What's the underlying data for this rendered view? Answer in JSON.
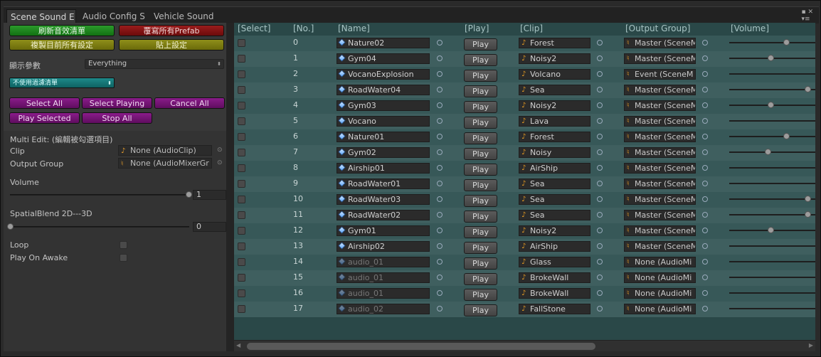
{
  "tabs": [
    "Scene Sound E",
    "Audio Config S",
    "Vehicle Sound"
  ],
  "window_controls": "▪ ✕\n▾≡",
  "left": {
    "buttons": {
      "refresh": "刷新音效清單",
      "override": "覆寫所有Prefab",
      "copy": "複製目前所有設定",
      "paste": "貼上設定"
    },
    "display_label": "顯示參數",
    "display_value": "Everything",
    "filter_value": "不使用過濾清單",
    "select_all": "Select All",
    "select_playing": "Select Playing",
    "cancel_all": "Cancel All",
    "play_selected": "Play Selected",
    "stop_all": "Stop All",
    "multi_edit": "Multi Edit: (編輯被勾選項目)",
    "clip_label": "Clip",
    "clip_value": "None (AudioClip)",
    "output_label": "Output Group",
    "output_value": "None (AudioMixerGr",
    "volume_label": "Volume",
    "volume_value": "1",
    "volume_level": 1,
    "spatial_label": "SpatialBlend 2D---3D",
    "spatial_value": "0",
    "spatial_level": 0,
    "loop_label": "Loop",
    "awake_label": "Play On Awake"
  },
  "headers": {
    "select": "[Select]",
    "no": "[No.]",
    "name": "[Name]",
    "play": "[Play]",
    "clip": "[Clip]",
    "output": "[Output Group]",
    "volume": "[Volume]"
  },
  "play_label": "Play",
  "rows": [
    {
      "no": "0",
      "name": "Nature02",
      "clip": "Forest",
      "output": "Master (SceneM",
      "volume": 0.55,
      "dim": false
    },
    {
      "no": "1",
      "name": "Gym04",
      "clip": "Noisy2",
      "output": "Master (SceneM",
      "volume": 0.4,
      "dim": false
    },
    {
      "no": "2",
      "name": "VocanoExplosion",
      "clip": "Volcano",
      "output": "Event (SceneM",
      "volume": 1.0,
      "dim": false
    },
    {
      "no": "3",
      "name": "RoadWater04",
      "clip": "Sea",
      "output": "Master (SceneM",
      "volume": 0.76,
      "dim": false
    },
    {
      "no": "4",
      "name": "Gym03",
      "clip": "Noisy2",
      "output": "Master (SceneM",
      "volume": 0.4,
      "dim": false
    },
    {
      "no": "5",
      "name": "Vocano",
      "clip": "Lava",
      "output": "Master (SceneM",
      "volume": 1.0,
      "dim": false
    },
    {
      "no": "6",
      "name": "Nature01",
      "clip": "Forest",
      "output": "Master (SceneM",
      "volume": 0.55,
      "dim": false
    },
    {
      "no": "7",
      "name": "Gym02",
      "clip": "Noisy",
      "output": "Master (SceneM",
      "volume": 0.37,
      "dim": false
    },
    {
      "no": "8",
      "name": "Airship01",
      "clip": "AirShip",
      "output": "Master (SceneM",
      "volume": 1.0,
      "dim": false
    },
    {
      "no": "9",
      "name": "RoadWater01",
      "clip": "Sea",
      "output": "Master (SceneM",
      "volume": 0.88,
      "dim": false
    },
    {
      "no": "10",
      "name": "RoadWater03",
      "clip": "Sea",
      "output": "Master (SceneM",
      "volume": 0.76,
      "dim": false
    },
    {
      "no": "11",
      "name": "RoadWater02",
      "clip": "Sea",
      "output": "Master (SceneM",
      "volume": 0.76,
      "dim": false
    },
    {
      "no": "12",
      "name": "Gym01",
      "clip": "Noisy2",
      "output": "Master (SceneM",
      "volume": 0.4,
      "dim": false
    },
    {
      "no": "13",
      "name": "Airship02",
      "clip": "AirShip",
      "output": "Master (SceneM",
      "volume": 1.0,
      "dim": false
    },
    {
      "no": "14",
      "name": "audio_01",
      "clip": "Glass",
      "output": "None (AudioMi",
      "volume": 1.0,
      "dim": true
    },
    {
      "no": "15",
      "name": "audio_01",
      "clip": "BrokeWall",
      "output": "None (AudioMi",
      "volume": 1.0,
      "dim": true
    },
    {
      "no": "16",
      "name": "audio_01",
      "clip": "BrokeWall",
      "output": "None (AudioMi",
      "volume": 1.0,
      "dim": true
    },
    {
      "no": "17",
      "name": "audio_02",
      "clip": "FallStone",
      "output": "None (AudioMi",
      "volume": 1.0,
      "dim": true
    }
  ]
}
